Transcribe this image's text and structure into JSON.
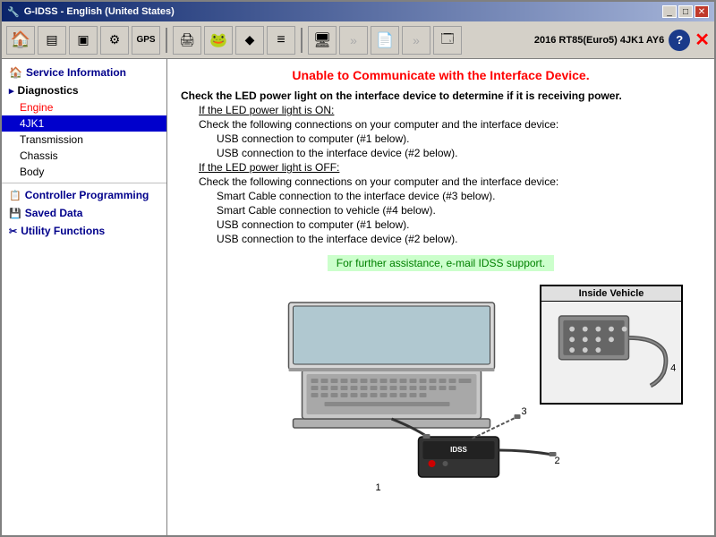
{
  "titlebar": {
    "title": "G-IDSS  - English (United States)",
    "vehicle": "2016 RT85(Euro5) 4JK1 AY6",
    "minimize_label": "_",
    "maximize_label": "□",
    "close_label": "✕"
  },
  "toolbar": {
    "home_icon": "🏠",
    "view1_icon": "▤",
    "view2_icon": "▣",
    "settings_icon": "⚙",
    "gps_icon": "GPS",
    "print_icon": "🖨",
    "frog_icon": "🐸",
    "arrow_icon": "◆",
    "lines_icon": "≡",
    "monitor_icon": "🖥",
    "arrows_icon": "»",
    "file_icon": "📄",
    "arrows2_icon": "»",
    "window_icon": "🗔",
    "help_label": "?",
    "close_label": "✕"
  },
  "sidebar": {
    "service_info_label": "Service Information",
    "diagnostics_label": "Diagnostics",
    "engine_label": "Engine",
    "4jk1_label": "4JK1",
    "transmission_label": "Transmission",
    "chassis_label": "Chassis",
    "body_label": "Body",
    "controller_prog_label": "Controller Programming",
    "saved_data_label": "Saved Data",
    "utility_functions_label": "Utility Functions"
  },
  "content": {
    "error_title": "Unable to Communicate with the Interface Device.",
    "check_led_bold": "Check the LED power light on the interface device to determine if it is receiving power.",
    "led_on_label": "If the LED power light is ON:",
    "led_on_line1": "Check the following connections on your computer and the interface device:",
    "led_on_line2": "USB connection to computer (#1 below).",
    "led_on_line3": "USB connection to the interface device (#2 below).",
    "led_off_label": "If the LED power light is OFF:",
    "led_off_line1": "Check the following connections on your computer and the interface device:",
    "led_off_line2": "Smart Cable connection to the interface device (#3 below).",
    "led_off_line3": "Smart Cable connection to vehicle (#4 below).",
    "led_off_line4": "USB connection to computer (#1 below).",
    "led_off_line5": "USB connection to the interface device (#2 below).",
    "assistance_label": "For further assistance, e-mail IDSS support.",
    "inside_vehicle_label": "Inside Vehicle",
    "num1": "1",
    "num2": "2",
    "num3": "3",
    "num4": "4"
  }
}
